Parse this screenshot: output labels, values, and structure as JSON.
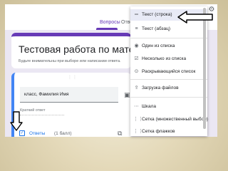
{
  "tabs": [
    {
      "label": "Вопросы",
      "active": true
    },
    {
      "label": "Отве",
      "active": false
    }
  ],
  "form": {
    "title": "Тестовая работа по матема",
    "description": "Будьте внимательны при выборе или написании ответа."
  },
  "question": {
    "text": "класс, Фамилия Имя",
    "short_answer": "Краткий ответ",
    "answers_label": "Ответы",
    "points": "(1 балл)"
  },
  "menu": {
    "items": [
      {
        "label": "Текст (строка)",
        "icon": "short-text-icon",
        "selected": true
      },
      {
        "label": "Текст (абзац)",
        "icon": "paragraph-icon"
      },
      {
        "label": "Один из списка",
        "icon": "radio-icon"
      },
      {
        "label": "Несколько из списка",
        "icon": "checkbox-icon"
      },
      {
        "label": "Раскрывающийся список",
        "icon": "dropdown-icon"
      },
      {
        "label": "Загрузка файлов",
        "icon": "upload-icon"
      },
      {
        "label": "Шкала",
        "icon": "linear-scale-icon"
      },
      {
        "label": "Сетка (множественный выбор)",
        "icon": "grid-icon"
      },
      {
        "label": "Сетка флажков",
        "icon": "checkbox-grid-icon"
      }
    ]
  },
  "colors": {
    "accent": "#673ab7",
    "question_border": "#4285f4",
    "link": "#1a73e8",
    "background": "#e4d9b9"
  }
}
